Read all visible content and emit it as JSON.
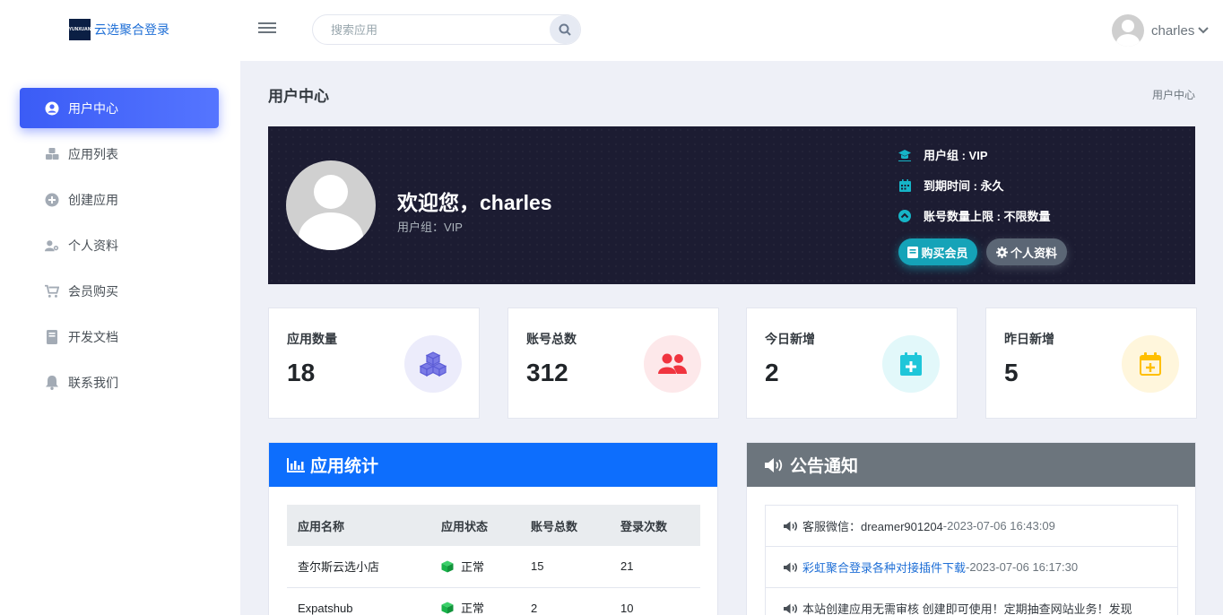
{
  "header": {
    "logo_mark": "YUNXUAN",
    "logo_text": "云选聚合登录",
    "search_placeholder": "搜索应用",
    "user_name": "charles"
  },
  "sidebar": {
    "items": [
      {
        "label": "用户中心",
        "icon": "user-circle-icon",
        "active": true
      },
      {
        "label": "应用列表",
        "icon": "cubes-icon"
      },
      {
        "label": "创建应用",
        "icon": "plus-circle-icon"
      },
      {
        "label": "个人资料",
        "icon": "user-cog-icon"
      },
      {
        "label": "会员购买",
        "icon": "cart-icon"
      },
      {
        "label": "开发文档",
        "icon": "book-icon"
      },
      {
        "label": "联系我们",
        "icon": "bell-icon"
      }
    ]
  },
  "page": {
    "title": "用户中心",
    "breadcrumb": "用户中心"
  },
  "hero": {
    "welcome": "欢迎您，charles",
    "group_line": "用户组：VIP",
    "info": [
      {
        "label": "用户组 : VIP",
        "icon": "graduation-cap-icon"
      },
      {
        "label": "到期时间 : 永久",
        "icon": "calendar-icon"
      },
      {
        "label": "账号数量上限 : 不限数量",
        "icon": "chevron-circle-up-icon"
      }
    ],
    "buy_label": "购买会员",
    "profile_label": "个人资料"
  },
  "stats": [
    {
      "label": "应用数量",
      "value": "18",
      "icon": "cubes-icon",
      "color": "#5b5bd6",
      "bg": "#ececfb"
    },
    {
      "label": "账号总数",
      "value": "312",
      "icon": "users-icon",
      "color": "#f0343f",
      "bg": "#fde8ea"
    },
    {
      "label": "今日新增",
      "value": "2",
      "icon": "calendar-plus-icon",
      "color": "#1ec6d9",
      "bg": "#e2f8fa"
    },
    {
      "label": "昨日新增",
      "value": "5",
      "icon": "calendar-plus-icon",
      "color": "#ffbf00",
      "bg": "#fff6dc"
    }
  ],
  "app_stats": {
    "title": "应用统计",
    "columns": [
      "应用名称",
      "应用状态",
      "账号总数",
      "登录次数"
    ],
    "rows": [
      {
        "name": "查尔斯云选小店",
        "status": "正常",
        "accounts": "15",
        "logins": "21"
      },
      {
        "name": "Expatshub",
        "status": "正常",
        "accounts": "2",
        "logins": "10"
      }
    ]
  },
  "notices": {
    "title": "公告通知",
    "items": [
      {
        "text": "客服微信：dreamer901204",
        "time": " -2023-07-06 16:43:09",
        "is_link": false
      },
      {
        "text": "彩虹聚合登录各种对接插件下载",
        "time": " -2023-07-06 16:17:30",
        "is_link": true
      },
      {
        "text": "本站创建应用无需审核 创建即可使用！定期抽查网站业务！发现",
        "time": "",
        "is_link": false
      }
    ]
  },
  "colors": {
    "accent": "#3d5afe",
    "stats_head": "#0d6efd",
    "notice_head": "#6c757d",
    "status_ok": "#19b34a"
  }
}
